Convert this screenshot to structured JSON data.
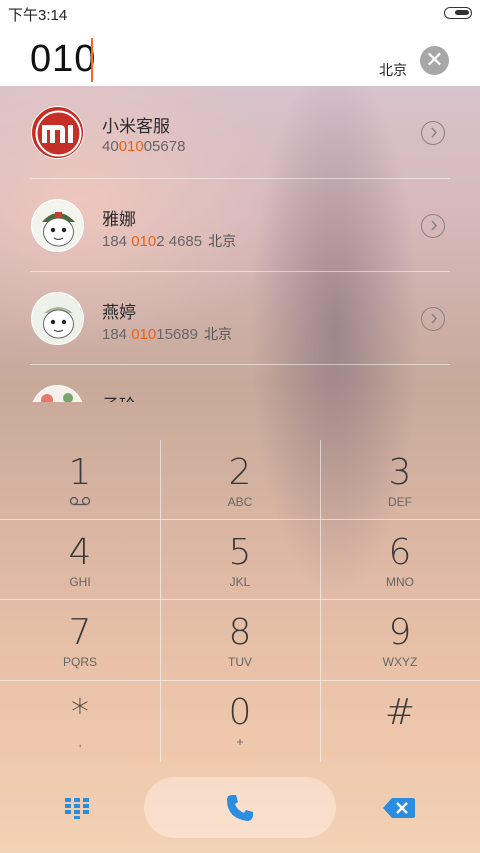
{
  "status_bar": {
    "time": "下午3:14"
  },
  "dial_input": {
    "value": "010",
    "location": "北京",
    "clear_symbol": "✕"
  },
  "contacts": [
    {
      "name": "小米客服",
      "number_parts": [
        "40",
        "010",
        "05678"
      ],
      "location": "",
      "avatar": "mi-logo"
    },
    {
      "name": "雅娜",
      "number_parts": [
        "184 ",
        "010",
        "2 4685"
      ],
      "location": "北京",
      "avatar": "mitu-avatar"
    },
    {
      "name": "燕婷",
      "number_parts": [
        "184 ",
        "010",
        "15689"
      ],
      "location": "北京",
      "avatar": "mitu-avatar"
    },
    {
      "name": "子玲",
      "number_parts": [
        "",
        "",
        ""
      ],
      "location": "",
      "avatar": "floral-avatar"
    }
  ],
  "keypad": [
    {
      "digit": "1",
      "letters": ""
    },
    {
      "digit": "2",
      "letters": "ABC"
    },
    {
      "digit": "3",
      "letters": "DEF"
    },
    {
      "digit": "4",
      "letters": "GHI"
    },
    {
      "digit": "5",
      "letters": "JKL"
    },
    {
      "digit": "6",
      "letters": "MNO"
    },
    {
      "digit": "7",
      "letters": "PQRS"
    },
    {
      "digit": "8",
      "letters": "TUV"
    },
    {
      "digit": "9",
      "letters": "WXYZ"
    },
    {
      "digit": "*",
      "letters": ","
    },
    {
      "digit": "0",
      "letters": "+"
    },
    {
      "digit": "#",
      "letters": ""
    }
  ],
  "colors": {
    "accent": "#e8621a",
    "call_blue": "#2a8de0"
  },
  "icons": {
    "clear": "close-icon",
    "chevron": "chevron-right-icon",
    "voicemail": "voicemail-icon",
    "keypad_toggle": "dialpad-grid-icon",
    "call": "phone-icon",
    "delete": "backspace-icon"
  }
}
